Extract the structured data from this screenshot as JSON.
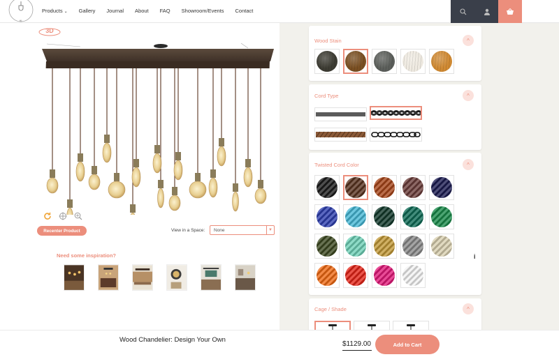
{
  "brand": {
    "logo_text": "HANGING LIGHTS CHANDELIERS"
  },
  "nav": {
    "items": [
      {
        "label": "Products",
        "has_dropdown": true
      },
      {
        "label": "Gallery"
      },
      {
        "label": "Journal"
      },
      {
        "label": "About"
      },
      {
        "label": "FAQ"
      },
      {
        "label": "Showroom/Events"
      },
      {
        "label": "Contact"
      }
    ]
  },
  "header_icons": [
    "search-icon",
    "user-icon",
    "cart-icon"
  ],
  "viewer": {
    "badge_3d": "3D",
    "recenter_label": "Recenter Product",
    "space_label": "View in a Space:",
    "space_value": "None",
    "inspiration_title": "Need some inspiration?",
    "inspiration_count": 6
  },
  "options": {
    "wood_stain": {
      "title": "Wood Stain",
      "toggle": "^",
      "swatches": [
        "#3d3c33",
        "#7a4f22",
        "#5c5f5b",
        "#efeae1",
        "#d08a33"
      ],
      "selected": 1
    },
    "cord_type": {
      "title": "Cord Type",
      "toggle": "^",
      "options": [
        "flat-gray",
        "twisted-black",
        "rope-brown",
        "chain-black"
      ],
      "selected": 1
    },
    "twisted_cord_color": {
      "title": "Twisted Cord Color",
      "toggle": "^",
      "swatches": [
        "#1c1c1c",
        "#5a3421",
        "#a8461a",
        "#6b3d3a",
        "#1c1c52",
        "#2e3fb0",
        "#47b8d6",
        "#12392b",
        "#0e6b56",
        "#1a8b4a",
        "#3e4a22",
        "#6fd1b7",
        "#c39a38",
        "#8b8b8b",
        "#d9cfb0",
        "#f06a14",
        "#e52518",
        "#e31a7a",
        "#f2f2f2"
      ],
      "selected": 1
    },
    "cage_shade": {
      "title": "Cage / Shade",
      "toggle": "^"
    }
  },
  "info_marker": "i",
  "bottom_bar": {
    "title": "Wood Chandelier: Design Your Own",
    "price": "$1129.00",
    "add_to_cart": "Add to Cart"
  },
  "colors": {
    "accent": "#ec8e7c",
    "panel_bg": "#f2f1ec",
    "dark_btn": "#3a3f4a"
  }
}
